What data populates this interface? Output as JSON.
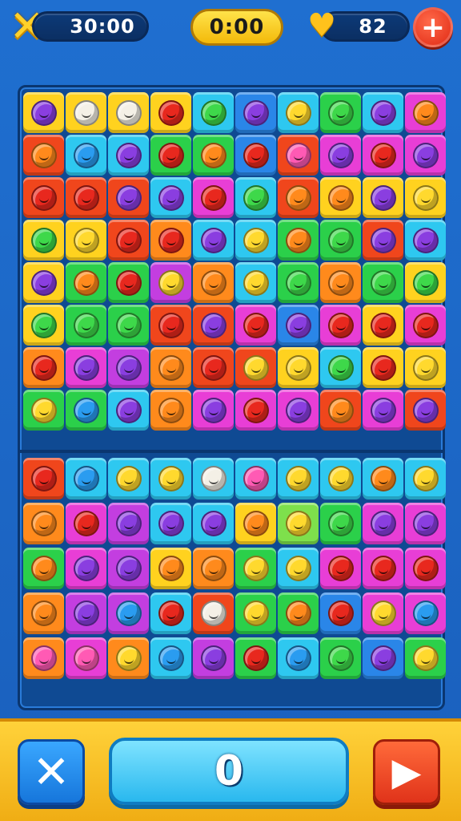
{
  "hud": {
    "left_timer": "30:00",
    "center_timer": "0:00",
    "lives": "82",
    "icons": {
      "left": "gold-x-icon",
      "heart": "gold-heart-icon",
      "plus": "plus-icon"
    }
  },
  "board": {
    "palette": {
      "Y": "#ffd21f",
      "C": "#2ec8f0",
      "G": "#2bd04a",
      "P": "#c33ee0",
      "O": "#ff8a1c",
      "R": "#f0461c",
      "B": "#2a86e8",
      "M": "#e83ed6",
      "L": "#7ee04c"
    },
    "fruit_colors": {
      "r": "#e8281e",
      "o": "#ff8a1c",
      "g": "#3ed84a",
      "p": "#8a3ee0",
      "y": "#ffd92e",
      "b": "#2a9cf0",
      "k": "#ff5ab4",
      "w": "#f4f0e6"
    },
    "top_rows": [
      [
        [
          "Y",
          "p"
        ],
        [
          "Y",
          "w"
        ],
        [
          "Y",
          "w"
        ],
        [
          "Y",
          "r"
        ],
        [
          "C",
          "g"
        ],
        [
          "B",
          "p"
        ],
        [
          "C",
          "y"
        ],
        [
          "G",
          "g"
        ],
        [
          "C",
          "p"
        ],
        [
          "M",
          "o"
        ]
      ],
      [
        [
          "R",
          "o"
        ],
        [
          "C",
          "b"
        ],
        [
          "C",
          "p"
        ],
        [
          "G",
          "r"
        ],
        [
          "G",
          "o"
        ],
        [
          "B",
          "r"
        ],
        [
          "R",
          "k"
        ],
        [
          "M",
          "p"
        ],
        [
          "M",
          "r"
        ],
        [
          "M",
          "p"
        ]
      ],
      [
        [
          "R",
          "r"
        ],
        [
          "R",
          "r"
        ],
        [
          "R",
          "p"
        ],
        [
          "C",
          "p"
        ],
        [
          "M",
          "r"
        ],
        [
          "C",
          "g"
        ],
        [
          "R",
          "o"
        ],
        [
          "Y",
          "o"
        ],
        [
          "Y",
          "p"
        ],
        [
          "Y",
          "y"
        ]
      ],
      [
        [
          "Y",
          "g"
        ],
        [
          "Y",
          "y"
        ],
        [
          "R",
          "r"
        ],
        [
          "O",
          "r"
        ],
        [
          "C",
          "p"
        ],
        [
          "C",
          "y"
        ],
        [
          "G",
          "o"
        ],
        [
          "G",
          "g"
        ],
        [
          "R",
          "p"
        ],
        [
          "C",
          "p"
        ]
      ],
      [
        [
          "Y",
          "p"
        ],
        [
          "G",
          "o"
        ],
        [
          "G",
          "r"
        ],
        [
          "P",
          "y"
        ],
        [
          "O",
          "o"
        ],
        [
          "C",
          "y"
        ],
        [
          "G",
          "g"
        ],
        [
          "O",
          "o"
        ],
        [
          "G",
          "g"
        ],
        [
          "Y",
          "g"
        ]
      ],
      [
        [
          "Y",
          "g"
        ],
        [
          "G",
          "g"
        ],
        [
          "G",
          "g"
        ],
        [
          "R",
          "r"
        ],
        [
          "R",
          "p"
        ],
        [
          "M",
          "r"
        ],
        [
          "B",
          "p"
        ],
        [
          "M",
          "r"
        ],
        [
          "Y",
          "r"
        ],
        [
          "M",
          "r"
        ]
      ],
      [
        [
          "O",
          "r"
        ],
        [
          "M",
          "p"
        ],
        [
          "P",
          "p"
        ],
        [
          "O",
          "o"
        ],
        [
          "R",
          "r"
        ],
        [
          "R",
          "y"
        ],
        [
          "Y",
          "y"
        ],
        [
          "C",
          "g"
        ],
        [
          "Y",
          "r"
        ],
        [
          "Y",
          "y"
        ]
      ],
      [
        [
          "G",
          "y"
        ],
        [
          "G",
          "b"
        ],
        [
          "C",
          "p"
        ],
        [
          "O",
          "o"
        ],
        [
          "M",
          "p"
        ],
        [
          "M",
          "r"
        ],
        [
          "M",
          "p"
        ],
        [
          "R",
          "o"
        ],
        [
          "M",
          "p"
        ],
        [
          "R",
          "p"
        ]
      ]
    ],
    "bottom_rows": [
      [
        [
          "R",
          "r"
        ],
        [
          "C",
          "b"
        ],
        [
          "C",
          "y"
        ],
        [
          "C",
          "y"
        ],
        [
          "C",
          "w"
        ],
        [
          "C",
          "k"
        ],
        [
          "C",
          "y"
        ],
        [
          "C",
          "y"
        ],
        [
          "C",
          "o"
        ],
        [
          "C",
          "y"
        ]
      ],
      [
        [
          "O",
          "o"
        ],
        [
          "M",
          "r"
        ],
        [
          "P",
          "p"
        ],
        [
          "C",
          "p"
        ],
        [
          "C",
          "p"
        ],
        [
          "Y",
          "o"
        ],
        [
          "L",
          "y"
        ],
        [
          "G",
          "g"
        ],
        [
          "M",
          "p"
        ],
        [
          "M",
          "p"
        ]
      ],
      [
        [
          "G",
          "o"
        ],
        [
          "M",
          "p"
        ],
        [
          "P",
          "p"
        ],
        [
          "Y",
          "o"
        ],
        [
          "O",
          "o"
        ],
        [
          "G",
          "y"
        ],
        [
          "C",
          "y"
        ],
        [
          "M",
          "r"
        ],
        [
          "M",
          "r"
        ],
        [
          "M",
          "r"
        ]
      ],
      [
        [
          "O",
          "o"
        ],
        [
          "P",
          "p"
        ],
        [
          "P",
          "b"
        ],
        [
          "C",
          "r"
        ],
        [
          "R",
          "w"
        ],
        [
          "G",
          "y"
        ],
        [
          "G",
          "o"
        ],
        [
          "B",
          "r"
        ],
        [
          "M",
          "y"
        ],
        [
          "M",
          "b"
        ]
      ],
      [
        [
          "O",
          "k"
        ],
        [
          "M",
          "k"
        ],
        [
          "O",
          "y"
        ],
        [
          "C",
          "b"
        ],
        [
          "P",
          "p"
        ],
        [
          "G",
          "r"
        ],
        [
          "C",
          "b"
        ],
        [
          "G",
          "g"
        ],
        [
          "B",
          "p"
        ],
        [
          "G",
          "y"
        ]
      ]
    ]
  },
  "footer": {
    "score": "0",
    "cancel_icon": "close-icon",
    "play_icon": "play-icon"
  }
}
